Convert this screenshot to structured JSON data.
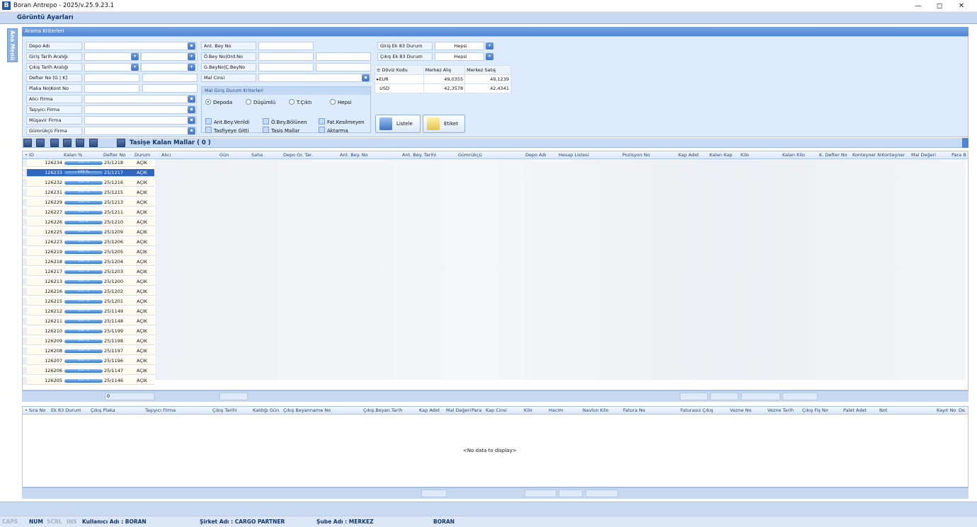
{
  "window": {
    "title": "Boran Antrepo - 2025/v.25.9.23.1",
    "controls": [
      "—",
      "◻",
      "✕"
    ]
  },
  "menu": {
    "title": "Görüntü Ayarları",
    "side_tab": "Ana Menü"
  },
  "criteria": {
    "header": "Arama Kriterleri",
    "left_labels": [
      "Depo Adı",
      "Giriş Tarih Aralığı",
      "Çıkış Tarih Aralığı",
      "Defter No [G | K]",
      "Plaka No|Kont No",
      "Alıcı Firma",
      "Taşıyıcı Firma",
      "Müşavir Firma",
      "Gümrükçü Firma"
    ],
    "mid_labels": [
      "Ant. Bey No",
      "Ö.Bey No|Ord.No",
      "G.BeyNo|Ç.BeyNo",
      "Mal Cinsi"
    ],
    "ek83": [
      {
        "label": "Giriş Ek 83 Durum",
        "value": "Hepsi"
      },
      {
        "label": "Çıkış Ek 83 Durum",
        "value": "Hepsi"
      }
    ],
    "mal_giris": {
      "title": "Mal Giriş Durum Kriterleri",
      "radios": [
        "Depoda",
        "Düşümlü",
        "T.Çıktı",
        "Hepsi"
      ],
      "checks": [
        "Ant.Bey.Verildi",
        "Ö.Bey.Bölünen",
        "Fat.Kesilmeyen",
        "Tasfiyeye Gitti",
        "Tasis Mallar",
        "Aktarma"
      ]
    },
    "currency": {
      "headers": [
        "Döviz Kodu",
        "Merkez Alış",
        "Merkez Satış"
      ],
      "rows": [
        {
          "code": "EUR",
          "buy": "49,0355",
          "sell": "49,1239"
        },
        {
          "code": "USD",
          "buy": "42,3578",
          "sell": "42,4341"
        }
      ]
    },
    "buttons": {
      "list": "Listele",
      "label": "Etiket"
    }
  },
  "toolbar": {
    "title": "Tasişe Kalan Mallar ( 0 )"
  },
  "grid1": {
    "columns": [
      "ID",
      "Kalan %",
      "Defter No",
      "Durum",
      "Alıcı",
      "Gün",
      "Saha",
      "Depo Gr. Tar.",
      "Ant. Bey. No",
      "Ant. Bey. Tarihi",
      "Gümrükçü",
      "Depo Adı",
      "Hesap Listesi",
      "Pozisyon No",
      "Kap Adet",
      "Kalan Kap",
      "Kilo",
      "Kalan Kilo",
      "K. Defter No",
      "Konteyner N",
      "Konteyner",
      "Mal Değeri",
      "Para B"
    ],
    "rows": [
      {
        "id": "126234",
        "pct": "100 %",
        "defter": "25/1218",
        "durum": "AÇIK"
      },
      {
        "id": "126233",
        "pct": "100 %",
        "defter": "25/1217",
        "durum": "AÇIK"
      },
      {
        "id": "126232",
        "pct": "100 %",
        "defter": "25/1216",
        "durum": "AÇIK"
      },
      {
        "id": "126231",
        "pct": "100 %",
        "defter": "25/1215",
        "durum": "AÇIK"
      },
      {
        "id": "126229",
        "pct": "100 %",
        "defter": "25/1213",
        "durum": "AÇIK"
      },
      {
        "id": "126227",
        "pct": "100 %",
        "defter": "25/1211",
        "durum": "AÇIK"
      },
      {
        "id": "126226",
        "pct": "93 %",
        "defter": "25/1210",
        "durum": "AÇIK"
      },
      {
        "id": "126225",
        "pct": "100 %",
        "defter": "25/1209",
        "durum": "AÇIK"
      },
      {
        "id": "126223",
        "pct": "100 %",
        "defter": "25/1206",
        "durum": "AÇIK"
      },
      {
        "id": "126219",
        "pct": "100 %",
        "defter": "25/1205",
        "durum": "AÇIK"
      },
      {
        "id": "126218",
        "pct": "100 %",
        "defter": "25/1204",
        "durum": "AÇIK"
      },
      {
        "id": "126217",
        "pct": "100 %",
        "defter": "25/1203",
        "durum": "AÇIK"
      },
      {
        "id": "126213",
        "pct": "100 %",
        "defter": "25/1200",
        "durum": "AÇIK"
      },
      {
        "id": "126216",
        "pct": "100 %",
        "defter": "25/1202",
        "durum": "AÇIK"
      },
      {
        "id": "126215",
        "pct": "100 %",
        "defter": "25/1201",
        "durum": "AÇIK"
      },
      {
        "id": "126212",
        "pct": "100 %",
        "defter": "25/1149",
        "durum": "AÇIK"
      },
      {
        "id": "126211",
        "pct": "100 %",
        "defter": "25/1148",
        "durum": "AÇIK"
      },
      {
        "id": "126210",
        "pct": "100 %",
        "defter": "25/1199",
        "durum": "AÇIK"
      },
      {
        "id": "126209",
        "pct": "100 %",
        "defter": "25/1198",
        "durum": "AÇIK"
      },
      {
        "id": "126208",
        "pct": "100 %",
        "defter": "25/1197",
        "durum": "AÇIK"
      },
      {
        "id": "126207",
        "pct": "100 %",
        "defter": "25/1196",
        "durum": "AÇIK"
      },
      {
        "id": "126206",
        "pct": "100 %",
        "defter": "25/1147",
        "durum": "AÇIK"
      },
      {
        "id": "126205",
        "pct": "100 %",
        "defter": "25/1146",
        "durum": "AÇIK"
      }
    ],
    "selected_index": 1,
    "footer_count": "0"
  },
  "grid2": {
    "columns": [
      "Sıra No",
      "Ek 83 Durum",
      "Çıkış Plaka",
      "Taşıyıcı Firma",
      "Çıkış Tarihi",
      "Kaldığı Gün",
      "Çıkış Beyanname No",
      "Çıkış.Beyan.Tarih",
      "Kap Adet",
      "Mal Değeri",
      "Para",
      "Kap Cinsi",
      "Kilo",
      "Hacim",
      "Navlun Kilo",
      "Fatura No",
      "Faturasız Çıkış",
      "Vezne No",
      "Vezne Tarih",
      "Çıkış Fiş No",
      "Palet Adet",
      "Not",
      "Kayıt No",
      "De"
    ],
    "empty": "<No data to display>"
  },
  "status": {
    "caps": "CAPS",
    "num": "NUM",
    "scrl": "SCRL",
    "ins": "INS",
    "user": "Kullanıcı Adı : BORAN",
    "company": "Şirket Adı   : CARGO PARTNER",
    "branch": "Şube Adı    : MERKEZ",
    "brand": "BORAN"
  }
}
